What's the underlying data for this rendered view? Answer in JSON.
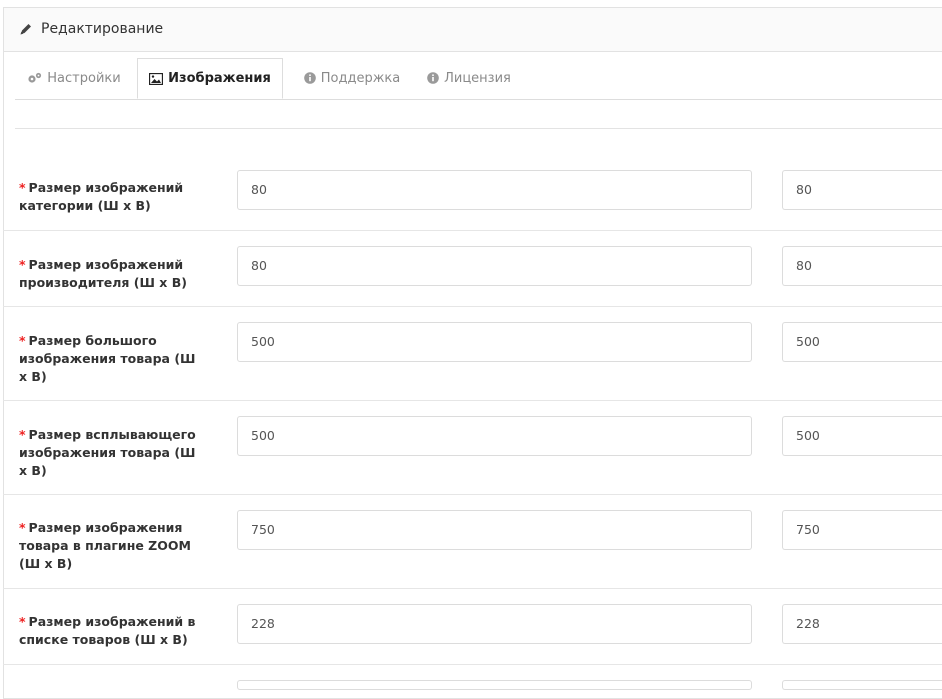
{
  "panel": {
    "title": "Редактирование",
    "title_icon": "pencil-icon"
  },
  "tabs": [
    {
      "label": "Настройки",
      "icon": "gears-icon",
      "active": false
    },
    {
      "label": "Изображения",
      "icon": "image-icon",
      "active": true
    },
    {
      "label": "Поддержка",
      "icon": "info-circle-icon",
      "active": false
    },
    {
      "label": "Лицензия",
      "icon": "info-circle-icon",
      "active": false
    }
  ],
  "required_mark": "*",
  "rows": [
    {
      "label": "Размер изображений категории (Ш x В)",
      "width": "80",
      "height": "80"
    },
    {
      "label": "Размер изображений производителя (Ш x В)",
      "width": "80",
      "height": "80"
    },
    {
      "label": "Размер большого изображения товара (Ш x В)",
      "width": "500",
      "height": "500"
    },
    {
      "label": "Размер всплывающего изображения товара (Ш x В)",
      "width": "500",
      "height": "500"
    },
    {
      "label": "Размер изображения товара в плагине ZOOM (Ш x В)",
      "width": "750",
      "height": "750"
    },
    {
      "label": "Размер изображений в списке товаров (Ш x В)",
      "width": "228",
      "height": "228"
    }
  ],
  "colors": {
    "required": "#e22222",
    "tab_inactive": "#8a8a8a",
    "border": "#dddddd"
  }
}
